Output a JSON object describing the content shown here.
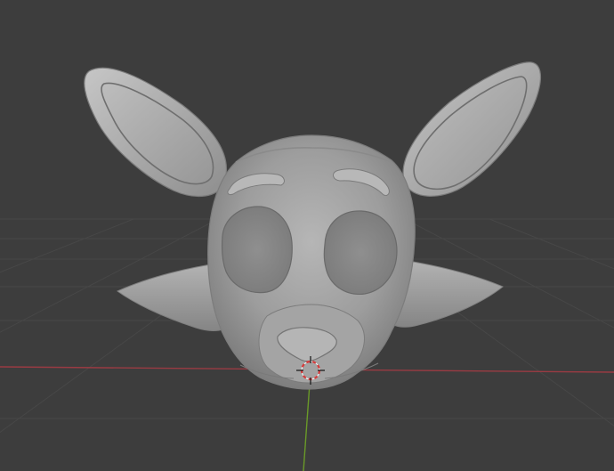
{
  "app": "Blender",
  "view": {
    "background_color": "#3d3d3d",
    "grid_color": "#4b4b4b",
    "x_axis_color": "#9a3b43",
    "y_axis_color": "#6a9a28",
    "mesh_base_color": "#9b9b9b",
    "mesh_shadow_color": "#6f6f6f",
    "mesh_highlight_color": "#c4c4c4",
    "cursor_ring_color": "#d63b3b"
  },
  "scene": {
    "object": "fox-mask-mesh",
    "shading": "solid",
    "features": [
      "left-ear",
      "right-ear",
      "left-eye-hole",
      "right-eye-hole",
      "left-brow",
      "right-brow",
      "left-cheek",
      "right-cheek",
      "snout",
      "nose"
    ]
  },
  "icons": {
    "cursor": "3d-cursor-icon"
  }
}
